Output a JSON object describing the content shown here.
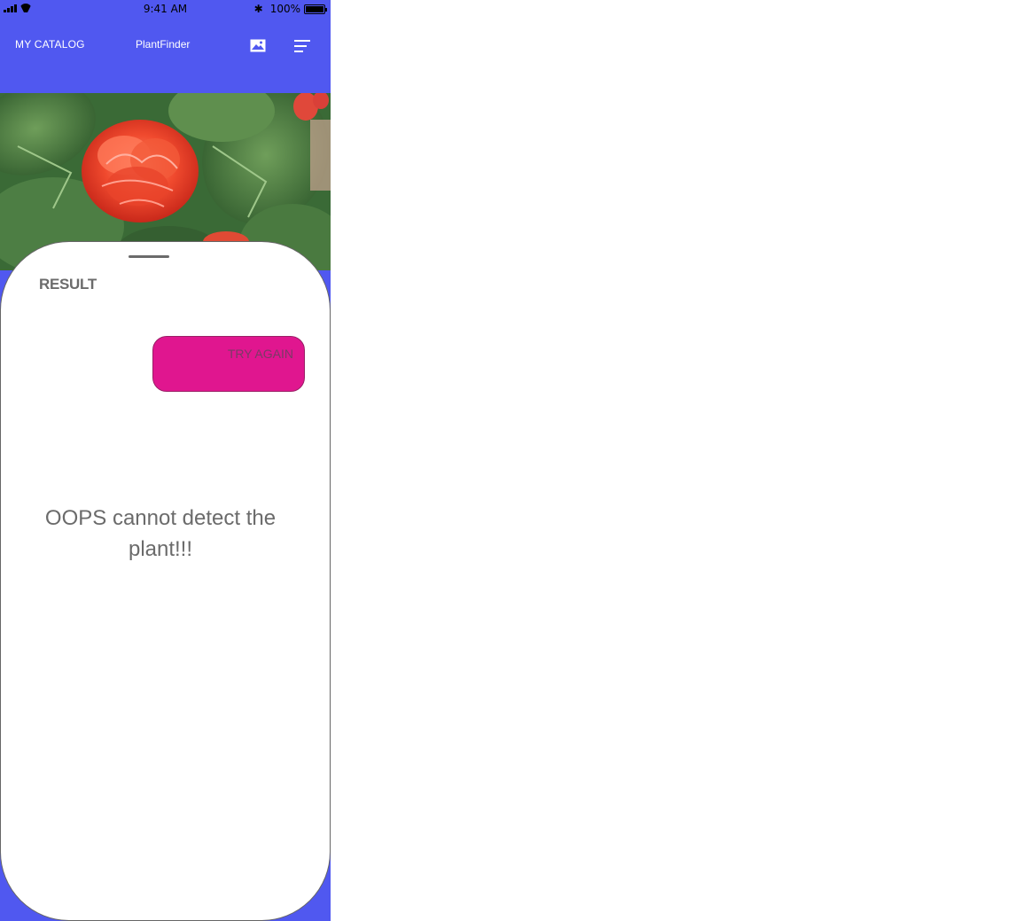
{
  "status_bar": {
    "time": "9:41 AM",
    "battery_text": "100%",
    "battery_level": 1.0
  },
  "nav": {
    "catalog_label": "MY CATALOG",
    "title": "PlantFinder",
    "icons": [
      "image-icon",
      "menu-icon"
    ]
  },
  "photo": {
    "subject": "red-flower-photo"
  },
  "result": {
    "heading": "RESULT",
    "try_again_label": "TRY AGAIN",
    "message": "OOPS cannot detect the plant!!!"
  },
  "colors": {
    "nav_background": "#5058f0",
    "button_background": "#e0168f",
    "text_gray": "#6b6b6b"
  }
}
